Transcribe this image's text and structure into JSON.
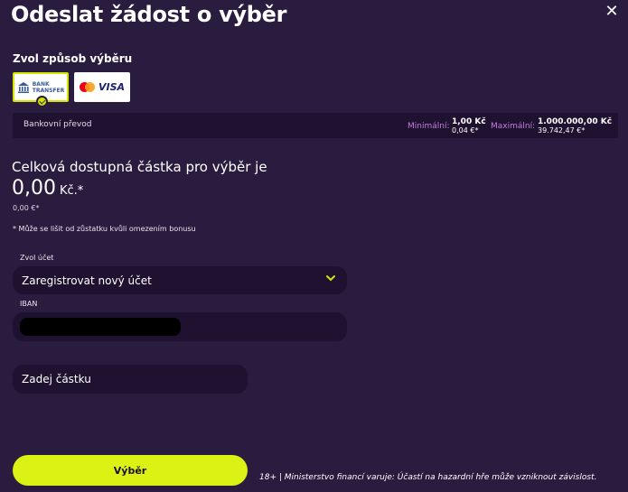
{
  "dialog": {
    "title": "Odeslat žádost o výběr",
    "close_symbol": "✕"
  },
  "methods": {
    "label": "Zvol způsob výběru",
    "items": [
      {
        "icon": "bank-icon",
        "label_line1": "BANK",
        "label_line2": "TRANSFER",
        "selected": true
      },
      {
        "icon": "mastercard-visa-icon",
        "visa_label": "VISA",
        "selected": false
      }
    ]
  },
  "method_info": {
    "name": "Bankovní převod",
    "min_label": "Minimální:",
    "min_czk": "1,00 Kč",
    "min_eur": "0,04 €*",
    "max_label": "Maximální:",
    "max_czk": "1.000.000,00 Kč",
    "max_eur": "39.742,47 €*"
  },
  "balance": {
    "title": "Celková dostupná částka pro výběr je",
    "amount": "0,00",
    "currency": "Kč.*",
    "amount_eur": "0,00 €*",
    "note": "* Může se lišit od zůstatku kvůli omezením bonusu"
  },
  "form": {
    "account_label": "Zvol účet",
    "account_value": "Zaregistrovat nový účet",
    "iban_label": "IBAN",
    "amount_placeholder": "Zadej částku"
  },
  "actions": {
    "submit_label": "Výběr"
  },
  "footer": {
    "text": "18+ | Ministerstvo financí varuje: Účastí na hazardní hře může vzniknout závislost."
  },
  "colors": {
    "background": "#2a1c3e",
    "field": "#1e1230",
    "accent": "#dcf215",
    "limit_label": "#c77ce0"
  }
}
